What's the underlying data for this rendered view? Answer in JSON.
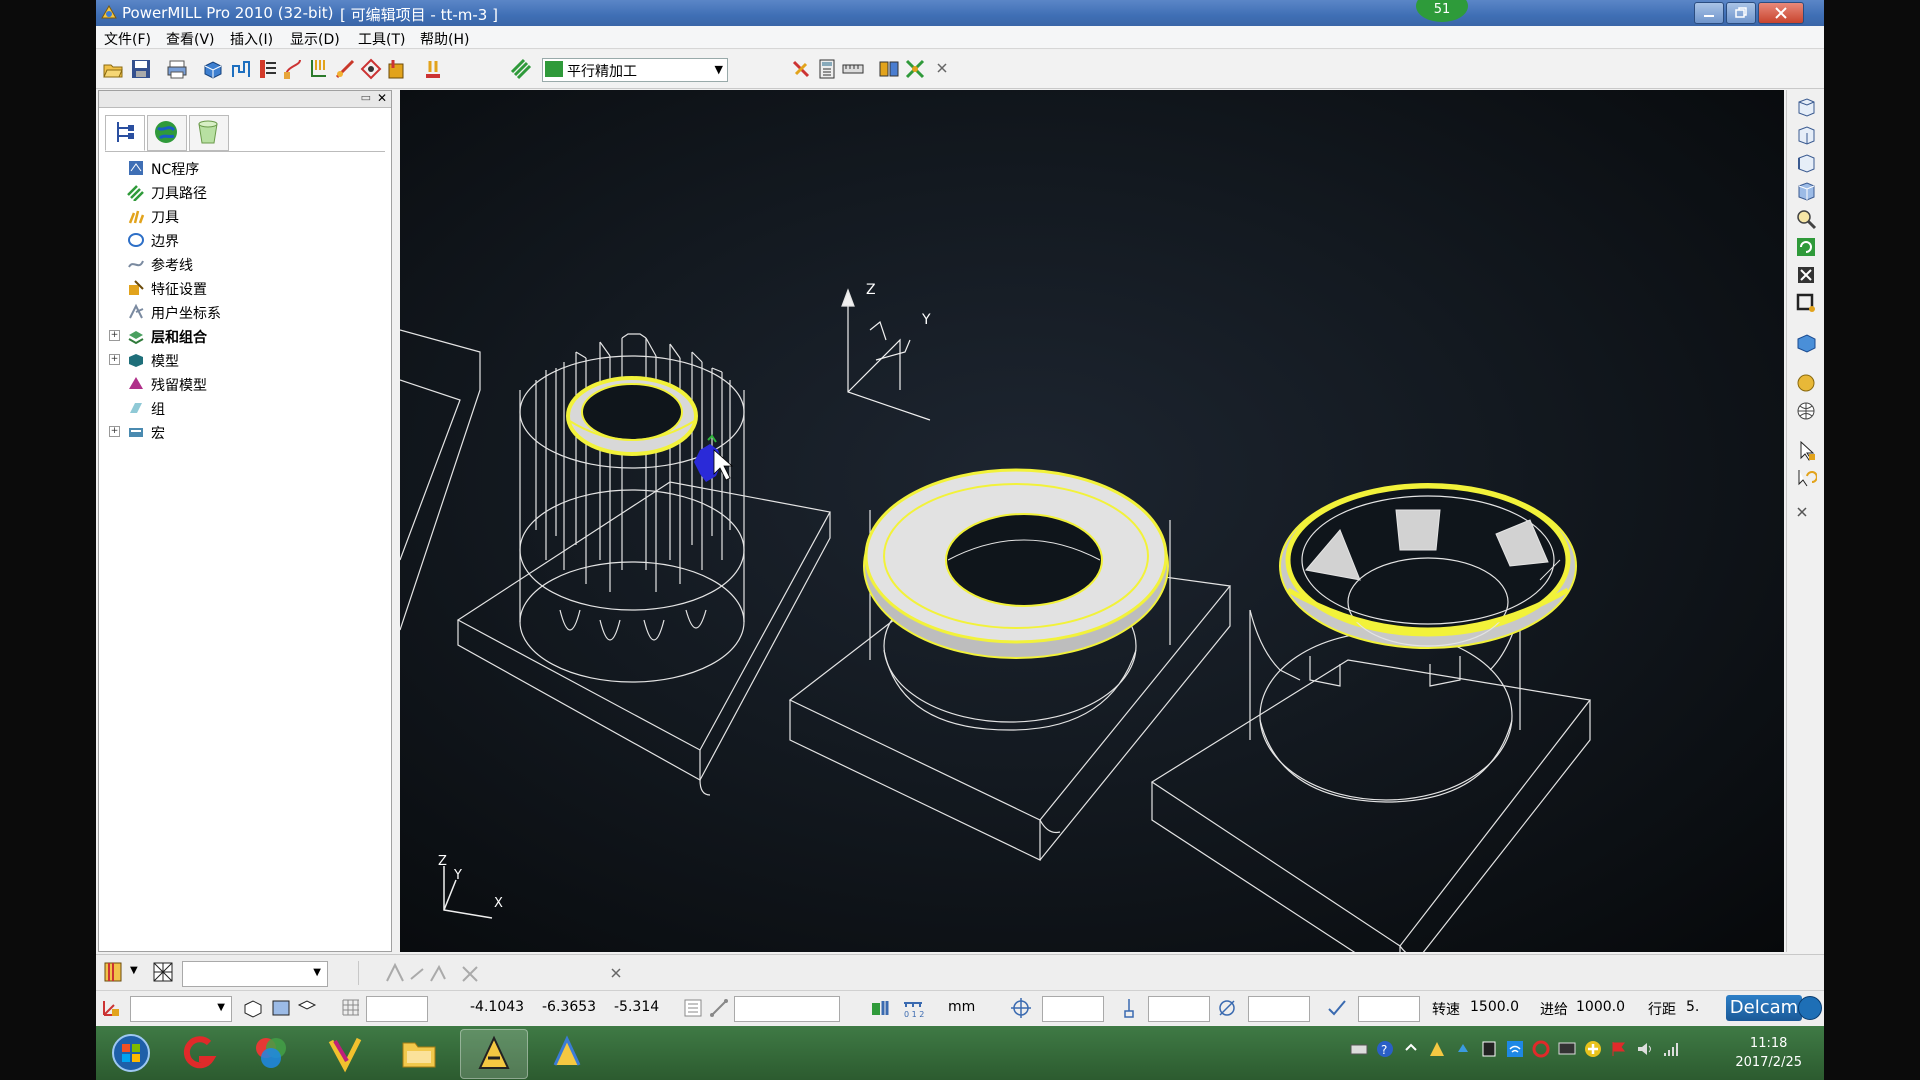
{
  "window": {
    "app_title": "PowerMILL Pro 2010 (32-bit)",
    "project_title": "[ 可编辑项目 - tt-m-3 ]",
    "badge": "51"
  },
  "menu": [
    "文件(F)",
    "查看(V)",
    "插入(I)",
    "显示(D)",
    "工具(T)",
    "帮助(H)"
  ],
  "toolbar": {
    "strategy_select": "平行精加工",
    "icons": [
      "open-project-icon",
      "save-project-icon",
      "print-icon",
      "block-icon",
      "rapid-move-icon",
      "feeds-speeds-icon",
      "leads-links-icon",
      "start-point-icon",
      "end-point-icon",
      "boundary-icon",
      "toolpath-verify-icon",
      "nc-output-icon",
      "strategy-icon"
    ],
    "right_icons": [
      "tool-select-icon",
      "calculator-icon",
      "ruler-icon",
      "compare-icon",
      "transform-icon"
    ]
  },
  "explorer": {
    "tabs": [
      "explorer-tree-icon",
      "explorer-globe-icon",
      "explorer-bucket-icon"
    ],
    "items": [
      {
        "label": "NC程序",
        "icon": "nc-program-icon",
        "expandable": false,
        "bold": false
      },
      {
        "label": "刀具路径",
        "icon": "toolpath-icon",
        "expandable": false,
        "bold": false
      },
      {
        "label": "刀具",
        "icon": "tool-icon",
        "expandable": false,
        "bold": false
      },
      {
        "label": "边界",
        "icon": "boundary-icon",
        "expandable": false,
        "bold": false
      },
      {
        "label": "参考线",
        "icon": "pattern-icon",
        "expandable": false,
        "bold": false
      },
      {
        "label": "特征设置",
        "icon": "feature-set-icon",
        "expandable": false,
        "bold": false
      },
      {
        "label": "用户坐标系",
        "icon": "workplane-icon",
        "expandable": false,
        "bold": false
      },
      {
        "label": "层和组合",
        "icon": "levels-sets-icon",
        "expandable": true,
        "bold": true
      },
      {
        "label": "模型",
        "icon": "model-icon",
        "expandable": true,
        "bold": false
      },
      {
        "label": "残留模型",
        "icon": "stock-model-icon",
        "expandable": false,
        "bold": false
      },
      {
        "label": "组",
        "icon": "group-icon",
        "expandable": false,
        "bold": false
      },
      {
        "label": "宏",
        "icon": "macro-icon",
        "expandable": true,
        "bold": false
      }
    ]
  },
  "viewport": {
    "triad_main": {
      "z": "Z",
      "y": "Y"
    },
    "triad_small": {
      "z": "Z",
      "y": "Y",
      "x": "X"
    },
    "colors": {
      "wire": "#e6e6e6",
      "highlight": "#f2f23a",
      "surface": "#d2d2d2",
      "cursor_blue": "#2a2ad8"
    }
  },
  "status": {
    "coord_x": "-4.1043",
    "coord_y": "-6.3653",
    "coord_z": "-5.314",
    "units": "mm",
    "spindle_label": "转速",
    "spindle_value": "1500.0",
    "feed_label": "进给",
    "feed_value": "1000.0",
    "stepover_label": "行距",
    "stepover_value": "5.",
    "brand": "Delcam"
  },
  "taskbar": {
    "time": "11:18",
    "date": "2017/2/25",
    "apps": [
      "start-orb-icon",
      "app-g-icon",
      "app-color-icon",
      "app-arrow-icon",
      "file-explorer-icon",
      "powermill-task-icon",
      "powermill-task2-icon"
    ]
  }
}
